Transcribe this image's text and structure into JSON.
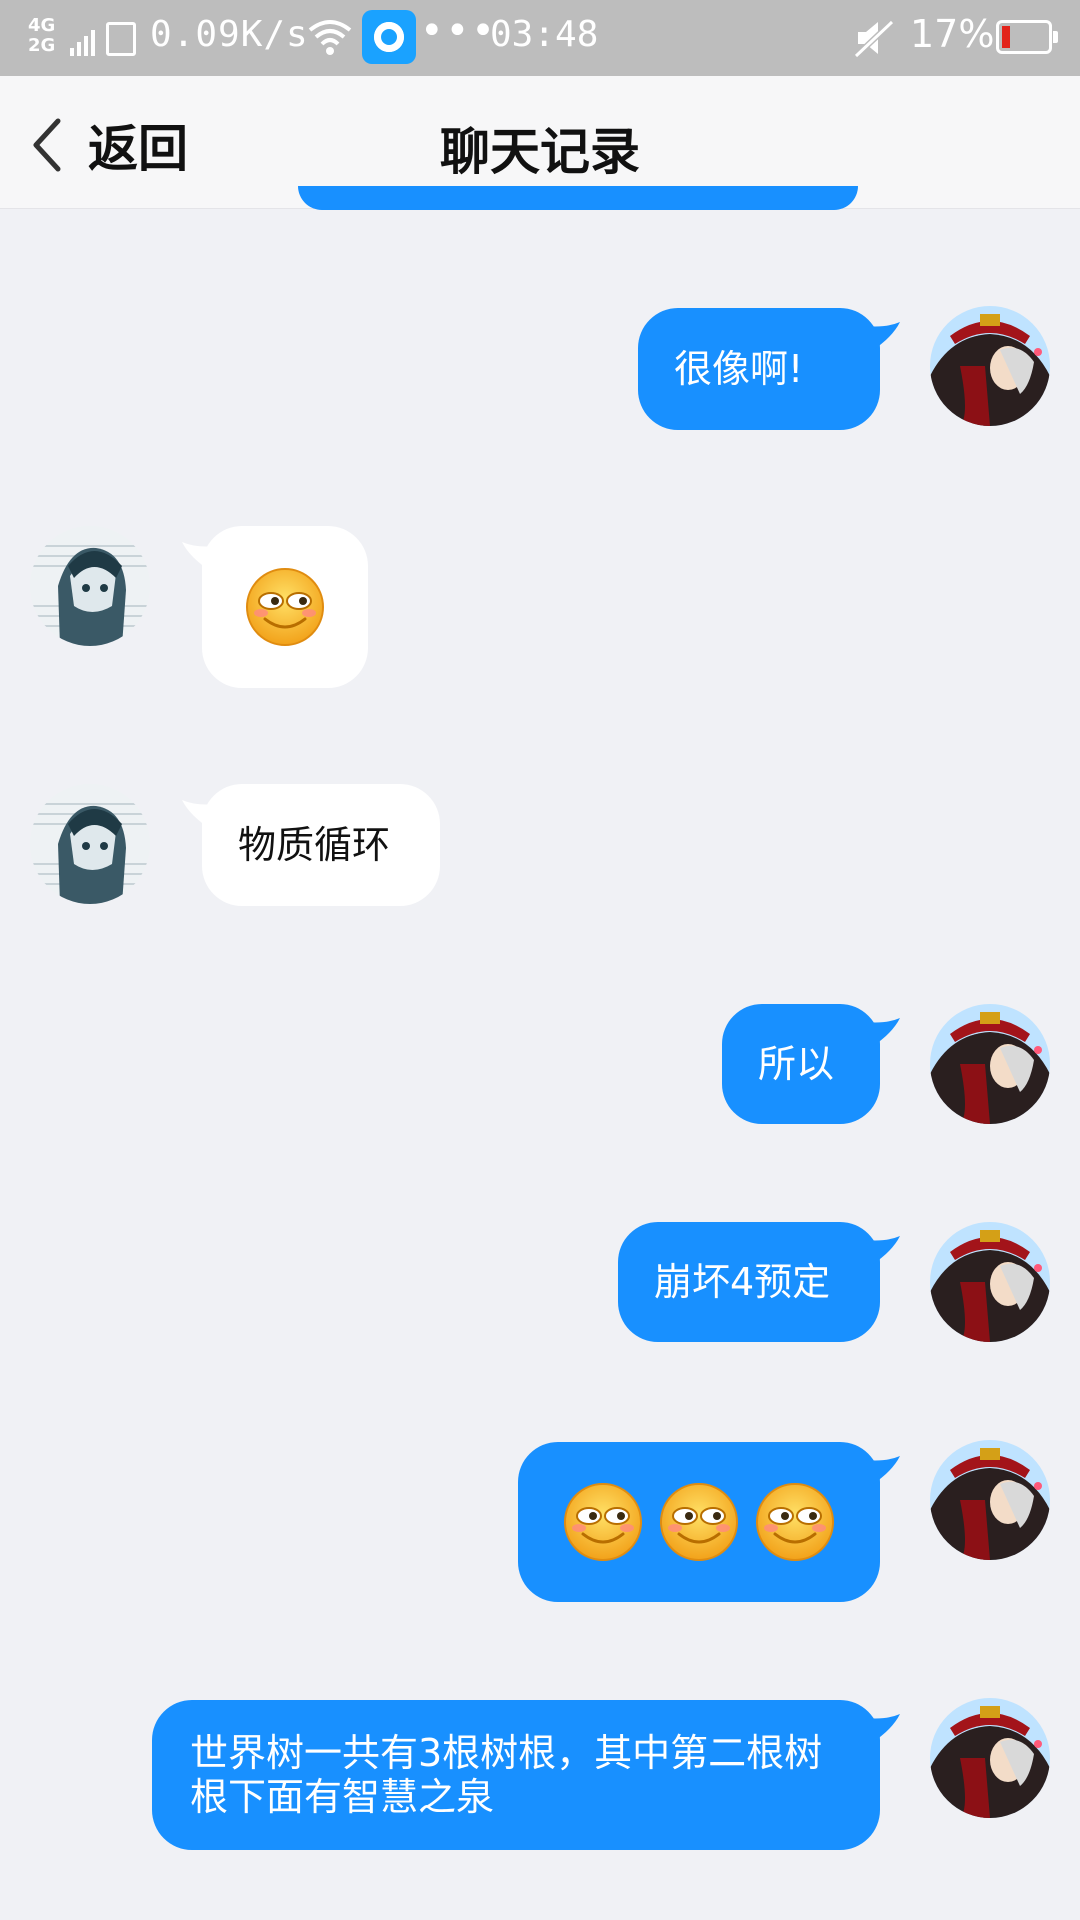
{
  "status_bar": {
    "network_top": "4G",
    "network_bottom": "2G",
    "speed": "0.09K/s",
    "more": "•••",
    "time": "03:48",
    "battery_percent": "17%"
  },
  "nav": {
    "back_label": "返回",
    "title": "聊天记录"
  },
  "messages": [
    {
      "side": "out",
      "text": "很像啊!"
    },
    {
      "side": "in",
      "text": "",
      "emoji_count": 1
    },
    {
      "side": "in",
      "text": "物质循环"
    },
    {
      "side": "out",
      "text": "所以"
    },
    {
      "side": "out",
      "text": "崩坏4预定"
    },
    {
      "side": "out",
      "text": "",
      "emoji_count": 3
    },
    {
      "side": "out",
      "text": "世界树一共有3根树根，其中第二根树根下面有智慧之泉"
    }
  ],
  "colors": {
    "out_bubble": "#1890ff",
    "in_bubble": "#ffffff",
    "background": "#f0f1f5",
    "status_bar": "#bdbdbd"
  }
}
